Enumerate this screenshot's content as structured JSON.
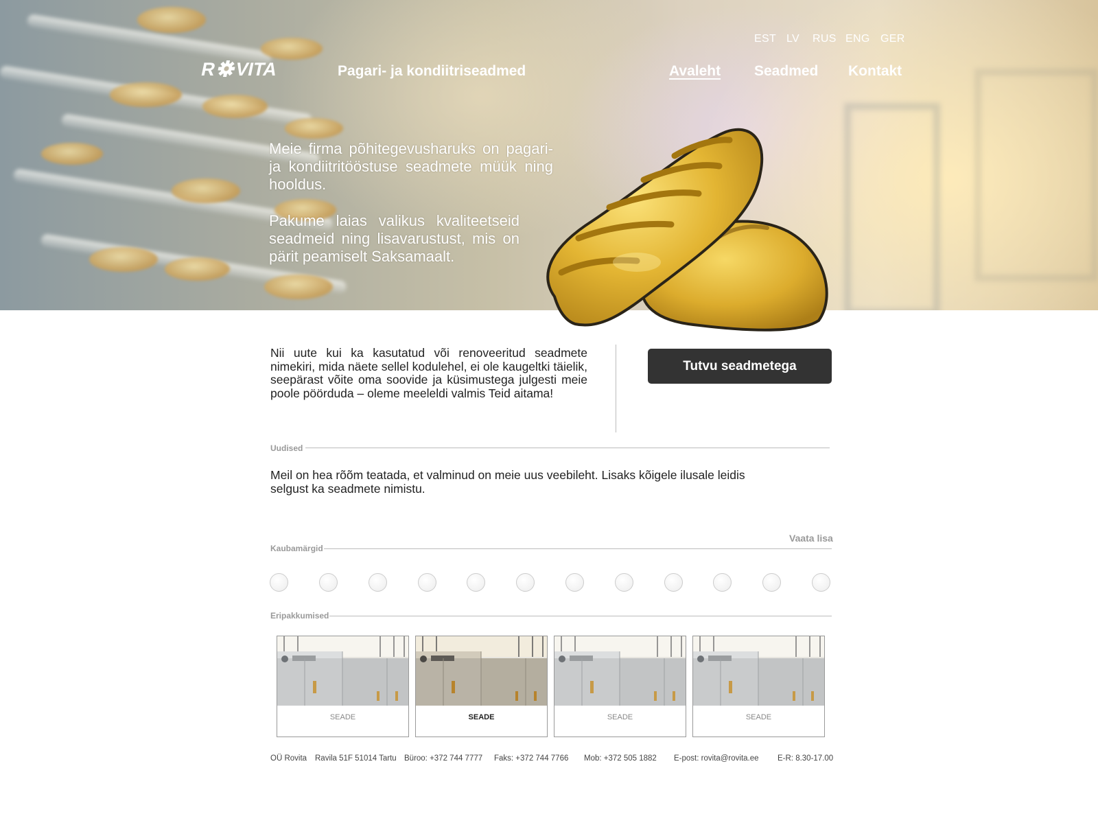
{
  "languages": [
    "EST",
    "LV",
    "RUS",
    "ENG",
    "GER"
  ],
  "brand": {
    "logo_text": "ROVITA",
    "tagline": "Pagari- ja kondiitriseadmed"
  },
  "nav": [
    {
      "label": "Avaleht",
      "active": true
    },
    {
      "label": "Seadmed",
      "active": false
    },
    {
      "label": "Kontakt",
      "active": false
    }
  ],
  "hero": {
    "paragraph_1": "Meie firma põhitegevusharuks on pagari- ja kondiitritööstuse seadmete müük ning hooldus.",
    "paragraph_2": "Pakume laias valikus kvaliteetseid seadmeid ning lisavarustust, mis on pärit peamiselt Saksamaalt."
  },
  "intro": {
    "text": "Nii uute kui ka kasutatud või renoveeritud seadmete nimekiri, mida näete sellel kodulehel, ei ole kaugeltki täielik, seepärast võite oma soovide ja küsimustega julgesti meie poole pöörduda – oleme meeleldi valmis Teid aitama!",
    "cta_label": "Tutvu seadmetega"
  },
  "news": {
    "section_label": "Uudised",
    "text": "Meil on hea rõõm teatada, et valminud on meie uus veebileht. Lisaks kõigele ilusale leidis selgust ka seadmete nimistu.",
    "more_label": "Vaata lisa"
  },
  "brands": {
    "section_label": "Kaubamärgid",
    "count": 12
  },
  "offers": {
    "section_label": "Eripakkumised",
    "items": [
      {
        "label": "SEADE",
        "active": false
      },
      {
        "label": "SEADE",
        "active": true
      },
      {
        "label": "SEADE",
        "active": false
      },
      {
        "label": "SEADE",
        "active": false
      }
    ]
  },
  "footer": {
    "company": "OÜ Rovita",
    "address": "Ravila 51F 51014 Tartu",
    "office": "Büroo: +372 744 7777",
    "fax": "Faks: +372 744 7766",
    "mobile": "Mob: +372 505 1882",
    "email": "E-post: rovita@rovita.ee",
    "hours": "E-R: 8.30-17.00"
  },
  "colors": {
    "button_bg": "#333333",
    "muted_text": "#999999",
    "rule": "#bbbbbb"
  }
}
